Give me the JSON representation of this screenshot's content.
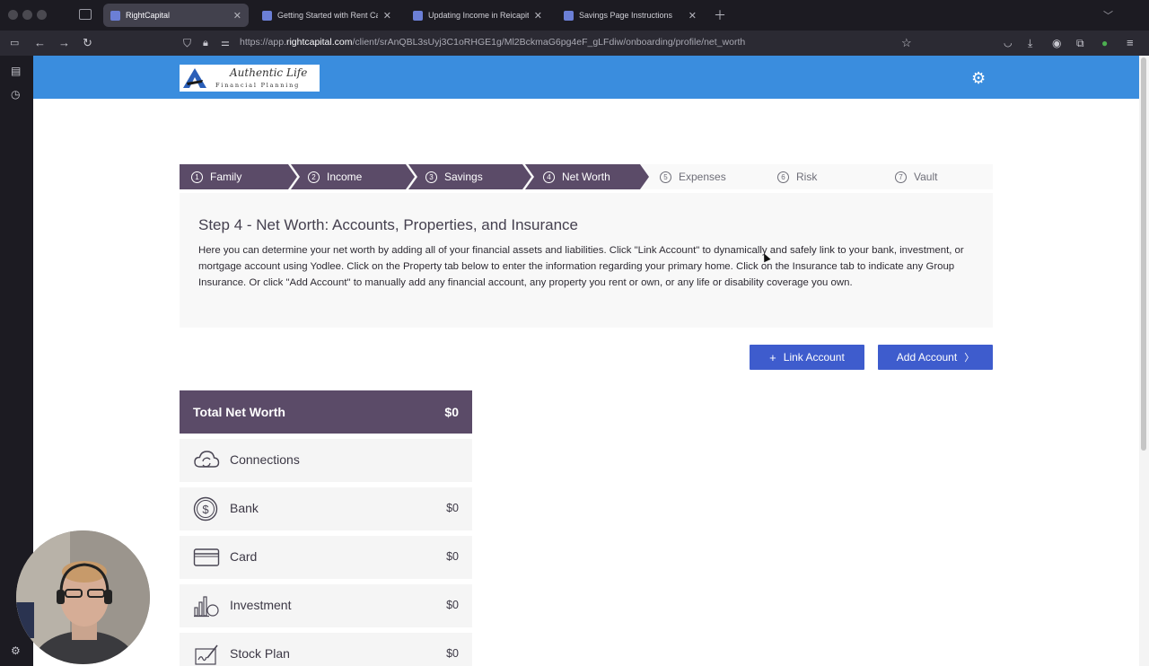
{
  "browser": {
    "tabs": [
      {
        "title": "RightCapital",
        "active": true
      },
      {
        "title": "Getting Started with Rent Capit",
        "active": false
      },
      {
        "title": "Updating Income in Reicapital -",
        "active": false
      },
      {
        "title": "Savings Page Instructions",
        "active": false
      }
    ],
    "url_prefix": "https://app.",
    "url_host": "rightcapital.com",
    "url_path": "/client/srAnQBL3sUyj3C1oRHGE1g/Ml2BckmaG6pg4eF_gLFdiw/onboarding/profile/net_worth"
  },
  "header": {
    "logo_line1": "Authentic Life",
    "logo_line2": "Financial Planning",
    "settings_icon": "gear-icon",
    "color": "#3a8dde"
  },
  "steps": [
    {
      "num": "1",
      "label": "Family",
      "state": "done"
    },
    {
      "num": "2",
      "label": "Income",
      "state": "done"
    },
    {
      "num": "3",
      "label": "Savings",
      "state": "done"
    },
    {
      "num": "4",
      "label": "Net Worth",
      "state": "current"
    },
    {
      "num": "5",
      "label": "Expenses",
      "state": "todo"
    },
    {
      "num": "6",
      "label": "Risk",
      "state": "todo"
    },
    {
      "num": "7",
      "label": "Vault",
      "state": "todo"
    }
  ],
  "intro": {
    "title": "Step 4 - Net Worth: Accounts, Properties, and Insurance",
    "body": "Here you can determine your net worth by adding all of your financial assets and liabilities. Click \"Link Account\" to dynamically and safely link to your bank, investment, or mortgage account using Yodlee. Click on the Property tab below to enter the information regarding your primary home. Click on the Insurance tab to indicate any Group Insurance. Or click \"Add Account\" to manually add any financial account, any property you rent or own, or any life or disability coverage you own."
  },
  "actions": {
    "link_label": "Link Account",
    "add_label": "Add Account",
    "button_color": "#3e5ccd"
  },
  "net_worth": {
    "title": "Total Net Worth",
    "value": "$0",
    "categories": [
      {
        "label": "Connections",
        "value": "",
        "icon": "cloud-sync-icon"
      },
      {
        "label": "Bank",
        "value": "$0",
        "icon": "dollar-coin-icon"
      },
      {
        "label": "Card",
        "value": "$0",
        "icon": "credit-card-icon"
      },
      {
        "label": "Investment",
        "value": "$0",
        "icon": "investment-chart-icon"
      },
      {
        "label": "Stock Plan",
        "value": "$0",
        "icon": "signature-icon"
      }
    ]
  },
  "colors": {
    "step_done": "#5b4b68",
    "step_todo": "#f9f9f9"
  }
}
